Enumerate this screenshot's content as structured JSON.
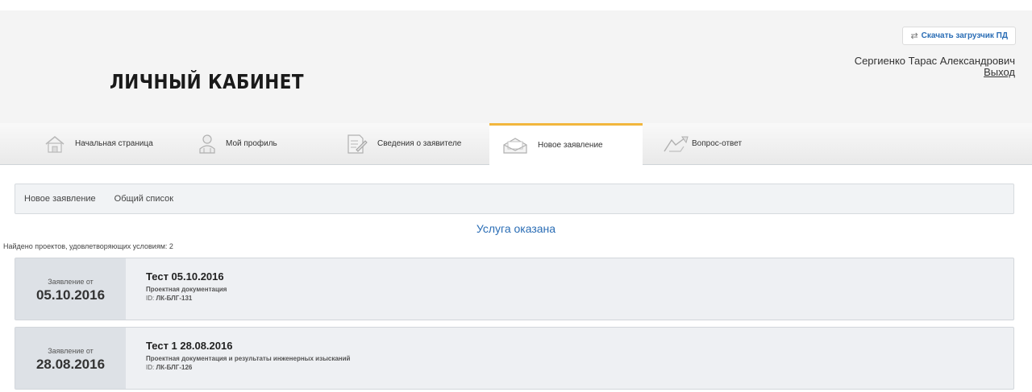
{
  "header": {
    "title": "ЛИЧНЫЙ КАБИНЕТ",
    "download_label": "Скачать загрузчик ПД",
    "user_name": "Сергиенко Тарас Александрович",
    "logout_label": "Выход"
  },
  "nav": {
    "items": [
      {
        "label": "Начальная страница",
        "icon": "home-icon"
      },
      {
        "label": "Мой профиль",
        "icon": "user-icon"
      },
      {
        "label": "Сведения о заявителе",
        "icon": "edit-document-icon"
      },
      {
        "label": "Новое заявление",
        "icon": "envelope-icon",
        "active": true
      },
      {
        "label": "Вопрос-ответ",
        "icon": "chat-arrows-icon"
      }
    ]
  },
  "breadcrumbs": [
    "Новое заявление",
    "Общий список"
  ],
  "section_title": "Услуга оказана",
  "found_text": "Найдено проектов, удовлетворяющих условиям: 2",
  "applications": [
    {
      "date_label": "Заявление от",
      "date": "05.10.2016",
      "title": "Тест 05.10.2016",
      "subtitle": "Проектная документация",
      "id_label": "ID:",
      "id_value": "ЛК-БЛГ-131"
    },
    {
      "date_label": "Заявление от",
      "date": "28.08.2016",
      "title": "Тест 1 28.08.2016",
      "subtitle": "Проектная документация и результаты инженерных изысканий",
      "id_label": "ID:",
      "id_value": "ЛК-БЛГ-126"
    }
  ],
  "colors": {
    "accent_link": "#2a6db5",
    "active_tab_border": "#f2b63d",
    "header_bg": "#f4f4f4"
  }
}
